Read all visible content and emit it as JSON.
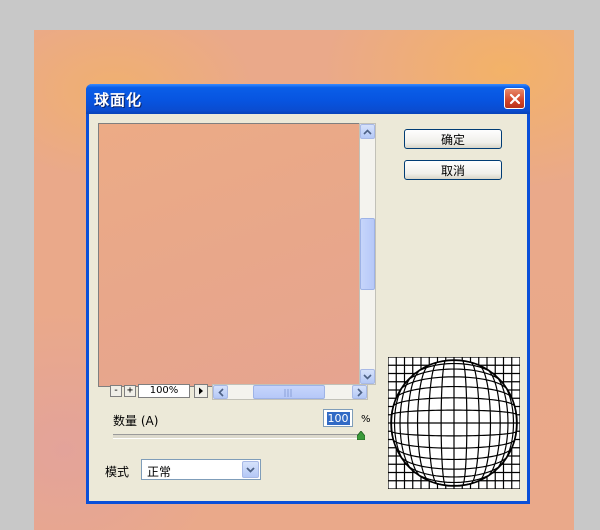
{
  "dialog": {
    "title": "球面化",
    "ok_label": "确定",
    "cancel_label": "取消"
  },
  "preview": {
    "zoom_out_label": "-",
    "zoom_in_label": "+",
    "zoom_value": "100%"
  },
  "amount": {
    "label": "数量 (A)",
    "value": "100",
    "unit": "%",
    "slider_level_percent": 100
  },
  "mode": {
    "label": "模式",
    "selected": "正常"
  },
  "colors": {
    "titlebar": "#0a5ee8",
    "dialog_bg": "#ece9d8",
    "preview_fill": "#e9a88a",
    "close_button": "#d2452a",
    "selection": "#316ac5"
  },
  "icons": {
    "close": "close-icon",
    "scroll_up": "arrow-up-icon",
    "scroll_down": "arrow-down-icon",
    "scroll_left": "arrow-left-icon",
    "scroll_right": "arrow-right-icon",
    "dropdown": "chevron-down-icon",
    "slider": "slider-triangle-icon",
    "spherize_grid": "spherize-grid-icon"
  }
}
